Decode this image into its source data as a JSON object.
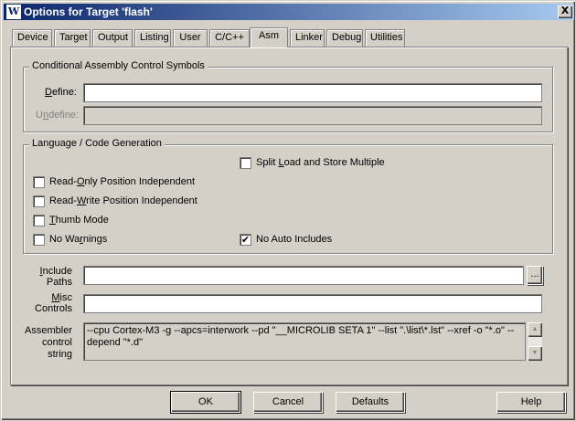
{
  "window": {
    "title": "Options for Target 'flash'",
    "icon": "keil-icon",
    "close_label": "X"
  },
  "tabs": [
    {
      "label": "Device"
    },
    {
      "label": "Target"
    },
    {
      "label": "Output"
    },
    {
      "label": "Listing"
    },
    {
      "label": "User"
    },
    {
      "label": "C/C++"
    },
    {
      "label": "Asm",
      "active": true
    },
    {
      "label": "Linker"
    },
    {
      "label": "Debug"
    },
    {
      "label": "Utilities"
    }
  ],
  "conditional": {
    "title": "Conditional Assembly Control Symbols",
    "define_label_u": "D",
    "define_label_rest": "efine:",
    "define_value": "",
    "undefine_label_pre": "U",
    "undefine_label_u": "n",
    "undefine_label_rest": "define:",
    "undefine_value": ""
  },
  "language": {
    "title": "Language / Code Generation",
    "split": {
      "pre": "Split ",
      "u": "L",
      "post": "oad and Store Multiple",
      "checked": false
    },
    "ro": {
      "pre": "Read-",
      "u": "O",
      "post": "nly Position Independent",
      "checked": false
    },
    "rw": {
      "pre": "Read-",
      "u": "W",
      "post": "rite Position Independent",
      "checked": false
    },
    "thumb": {
      "pre": "",
      "u": "T",
      "post": "humb Mode",
      "checked": false
    },
    "nowarn": {
      "pre": "No Wa",
      "u": "r",
      "post": "nings",
      "checked": false
    },
    "noauto": {
      "pre": "No Auto Includes",
      "u": "",
      "post": "",
      "checked": true
    }
  },
  "include": {
    "label_line1": "Include",
    "label_line2": "Paths",
    "value": "",
    "browse_label": "..."
  },
  "misc": {
    "label_line1": "Misc",
    "label_line2": "Controls",
    "value": ""
  },
  "assembler": {
    "label_line1": "Assembler",
    "label_line2": "control",
    "label_line3": "string",
    "value": "--cpu Cortex-M3 -g --apcs=interwork --pd \"__MICROLIB SETA 1\" --list \".\\list\\*.lst\" --xref -o \"*.o\" --depend \"*.d\""
  },
  "buttons": {
    "ok": "OK",
    "cancel": "Cancel",
    "defaults": "Defaults",
    "help": "Help"
  },
  "check_mark": "✔"
}
